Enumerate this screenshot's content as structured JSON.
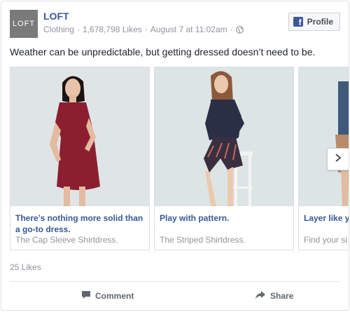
{
  "post": {
    "avatar_text": "LOFT",
    "page_name": "LOFT",
    "category": "Clothing",
    "likes_count": "1,678,798 Likes",
    "timestamp": "August 7 at 11:02am",
    "separator": "·",
    "profile_button": "Profile",
    "message": "Weather can be unpredictable, but getting dressed doesn’t need to be."
  },
  "carousel": {
    "cards": [
      {
        "title": "There’s nothing more solid than a go-to dress.",
        "subtitle": "The Cap Sleeve Shirtdress.",
        "dress_color": "#8b1f2f"
      },
      {
        "title": "Play with pattern.",
        "subtitle": "The Striped Shirtdress.",
        "dress_color": "#2a2f45"
      },
      {
        "title": "Layer like y",
        "subtitle": "Find your si",
        "dress_color": "#3f5a7a"
      }
    ],
    "next_icon": "chevron-right-icon"
  },
  "footer": {
    "likes": "25 Likes",
    "comment_label": "Comment",
    "share_label": "Share"
  },
  "colors": {
    "link_blue": "#365899",
    "muted_gray": "#90949c",
    "facebook_blue": "#3b5998"
  }
}
